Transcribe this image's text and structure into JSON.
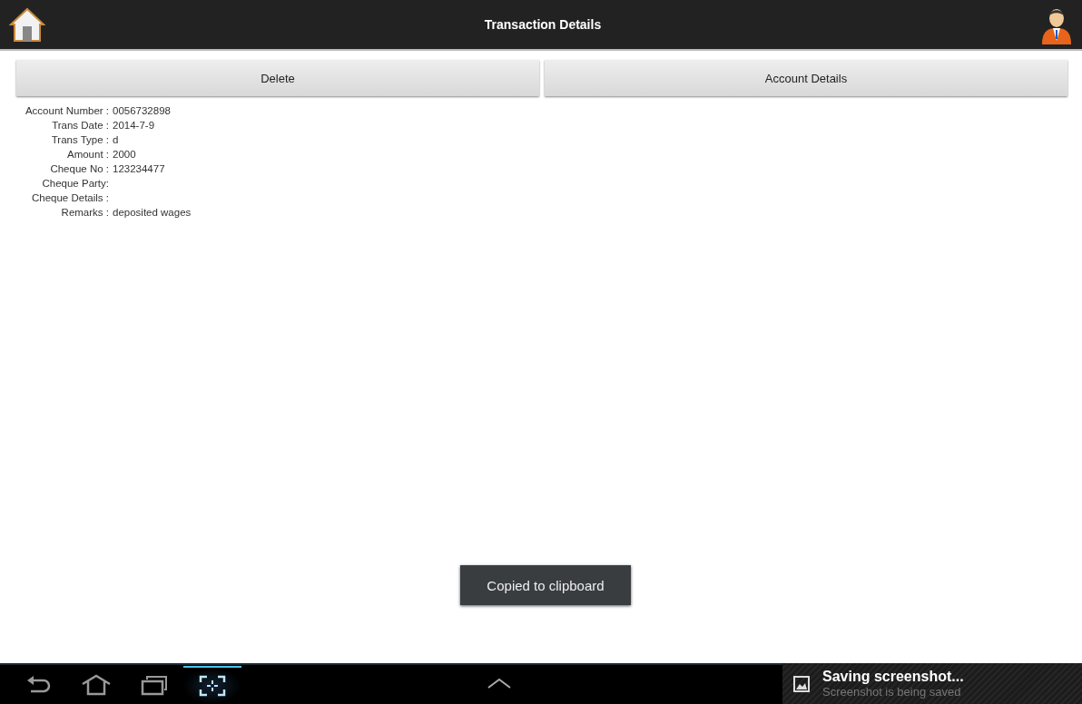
{
  "action_bar": {
    "title": "Transaction Details"
  },
  "buttons": [
    {
      "label": "Delete"
    },
    {
      "label": "Account Details"
    }
  ],
  "fields": [
    {
      "label": "Account Number :",
      "value": "0056732898"
    },
    {
      "label": "Trans Date :",
      "value": "2014-7-9"
    },
    {
      "label": "Trans Type :",
      "value": "d"
    },
    {
      "label": "Amount :",
      "value": "2000"
    },
    {
      "label": "Cheque No :",
      "value": "123234477"
    },
    {
      "label": "Cheque Party:"
    },
    {
      "label": "Cheque Details :"
    },
    {
      "label": "Remarks :",
      "value": "deposited wages"
    }
  ],
  "toast": "Copied to clipboard",
  "notification": {
    "title": "Saving screenshot...",
    "text": "Screenshot is being saved"
  }
}
